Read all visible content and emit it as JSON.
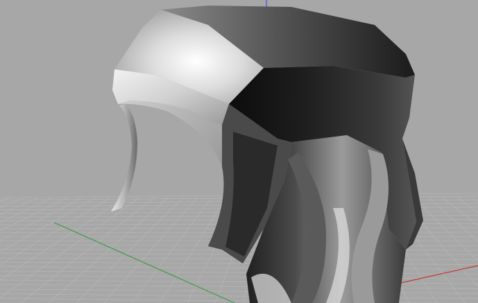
{
  "viewport": {
    "projection": "perspective",
    "shading": "rendered",
    "background_color": "#a7a7a7",
    "grid_line_color": "#b9b9b9",
    "axes": {
      "x_axis_color": "#c23a2c",
      "y_axis_color": "#3b9a45",
      "z_axis_color": "#3b4fd6"
    },
    "object": {
      "name": "",
      "material_color": "#cfcfcf",
      "shadow_color": "#141414"
    }
  }
}
